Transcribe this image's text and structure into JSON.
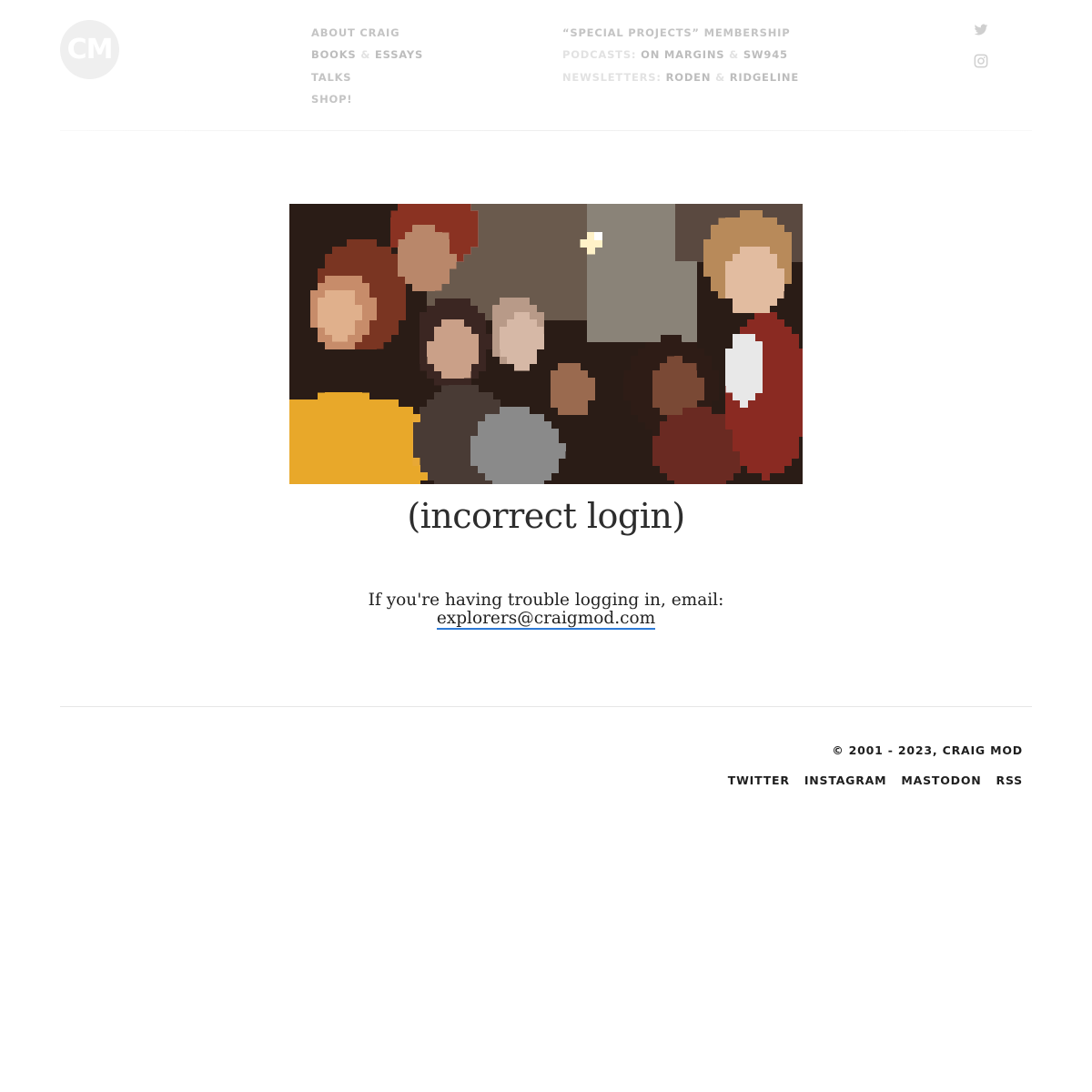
{
  "header": {
    "logo_text": "CM",
    "nav_col1": [
      {
        "label": "ABOUT CRAIG"
      },
      {
        "label_a": "BOOKS",
        "sep": "&",
        "label_b": "ESSAYS"
      },
      {
        "label": "TALKS"
      },
      {
        "label": "SHOP!"
      }
    ],
    "nav_col2": {
      "membership": "“SPECIAL PROJECTS” MEMBERSHIP",
      "podcasts_prefix": "PODCASTS:",
      "podcast_a": "ON MARGINS",
      "podcast_sep": "&",
      "podcast_b": "SW945",
      "newsletters_prefix": "NEWSLETTERS:",
      "newsletter_a": "RODEN",
      "newsletter_sep": "&",
      "newsletter_b": "RIDGELINE"
    },
    "social_icons": [
      "twitter-icon",
      "instagram-icon"
    ]
  },
  "main": {
    "hero_image": "pixelated-group-photo",
    "title": "(incorrect login)",
    "help_text": "If you're having trouble logging in, email:",
    "help_email": "explorers@craigmod.com",
    "link_color": "#2f7ad6"
  },
  "footer": {
    "copyright": "© 2001 - 2023, CRAIG MOD",
    "links": [
      "TWITTER",
      "INSTAGRAM",
      "MASTODON",
      "RSS"
    ]
  }
}
